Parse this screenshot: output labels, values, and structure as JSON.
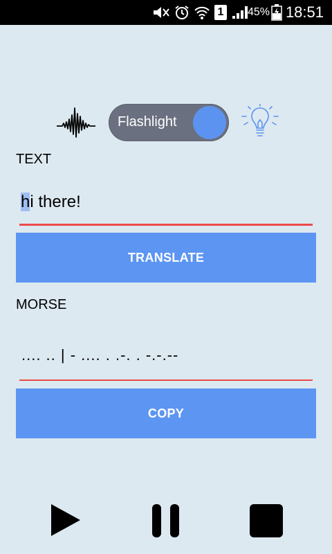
{
  "status_bar": {
    "battery_percent": "45%",
    "time": "18:51",
    "sim_label": "1",
    "icons": [
      "mute-icon",
      "alarm-icon",
      "wifi-icon",
      "sim-icon",
      "signal-icon",
      "battery-icon"
    ]
  },
  "mode": {
    "toggle_label": "Flashlight",
    "toggle_on": true,
    "left_icon": "sound-wave-icon",
    "right_icon": "lightbulb-icon",
    "accent": "#5c93f0"
  },
  "text_section": {
    "label": "TEXT",
    "value_selected": "h",
    "value_rest": "i there!"
  },
  "translate_button": {
    "label": "TRANSLATE"
  },
  "morse_section": {
    "label": "MORSE",
    "value": ".... .. | - .... . .-. . -.-.--"
  },
  "copy_button": {
    "label": "COPY"
  },
  "controls": {
    "play": "play-icon",
    "pause": "pause-icon",
    "stop": "stop-icon"
  },
  "colors": {
    "background": "#dde9f0",
    "button": "#5d95f2",
    "underline": "#ec4a4a",
    "toggle_track": "#6b7080"
  }
}
